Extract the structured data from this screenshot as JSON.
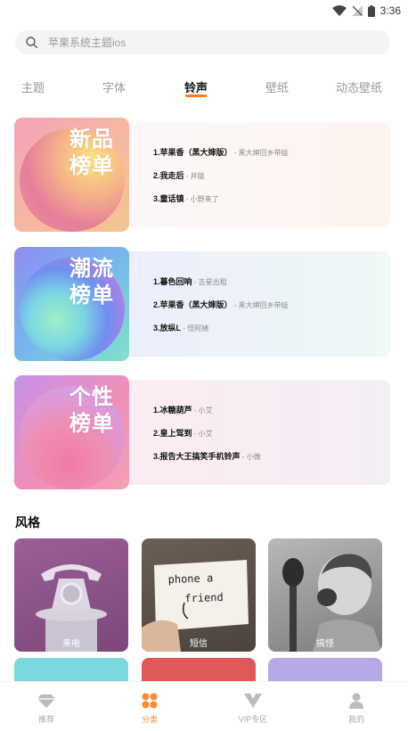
{
  "status_bar": {
    "time": "3:36"
  },
  "search": {
    "placeholder": "苹果系统主题ios"
  },
  "tabs": [
    {
      "label": "主题",
      "active": false
    },
    {
      "label": "字体",
      "active": false
    },
    {
      "label": "铃声",
      "active": true
    },
    {
      "label": "壁纸",
      "active": false
    },
    {
      "label": "动态壁纸",
      "active": false
    }
  ],
  "charts": [
    {
      "title_line1": "新品",
      "title_line2": "榜单",
      "items": [
        {
          "song": "1.苹果香（黑大婶版）",
          "artist": " - 黑大婶回乡带娃"
        },
        {
          "song": "2.我走后",
          "artist": " - 井胧"
        },
        {
          "song": "3.童话镇",
          "artist": " - 小野来了"
        }
      ]
    },
    {
      "title_line1": "潮流",
      "title_line2": "榜单",
      "items": [
        {
          "song": "1.暮色回响",
          "artist": " - 吉星出租"
        },
        {
          "song": "2.苹果香（黑大婶版）",
          "artist": " - 黑大婶回乡带娃"
        },
        {
          "song": "3.放纵L",
          "artist": " - 怪阿姨"
        }
      ]
    },
    {
      "title_line1": "个性",
      "title_line2": "榜单",
      "items": [
        {
          "song": "1.冰糖葫芦",
          "artist": " - 小艾"
        },
        {
          "song": "2.皇上驾到",
          "artist": " - 小艾"
        },
        {
          "song": "3.报告大王搞笑手机铃声",
          "artist": " - 小微"
        }
      ]
    }
  ],
  "style_section": {
    "title": "风格",
    "cards": [
      {
        "label": "来电"
      },
      {
        "label": "短信",
        "photo_text_line1": "phone   a",
        "photo_text_line2": "friend"
      },
      {
        "label": "搞怪"
      }
    ]
  },
  "bottom_nav": [
    {
      "label": "推荐",
      "icon": "diamond-icon",
      "active": false
    },
    {
      "label": "分类",
      "icon": "category-icon",
      "active": true
    },
    {
      "label": "VIP专区",
      "icon": "vip-icon",
      "active": false
    },
    {
      "label": "我的",
      "icon": "profile-icon",
      "active": false
    }
  ],
  "colors": {
    "accent": "#ff7a1a",
    "nav_active": "#ff8a2a"
  }
}
